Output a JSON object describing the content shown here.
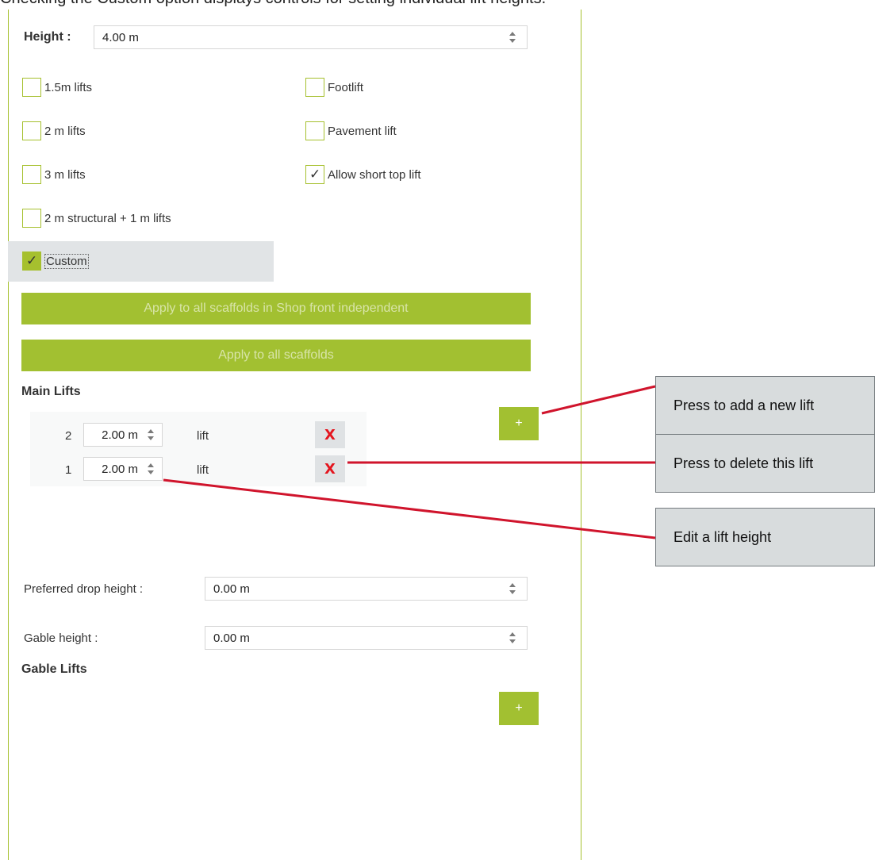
{
  "top_strip_text": "Checking the Custom option displays controls for setting individual lift heights.",
  "height": {
    "label": "Height :",
    "value": "4.00 m"
  },
  "options_left": [
    {
      "label": "1.5m lifts",
      "checked": false
    },
    {
      "label": "2 m lifts",
      "checked": false
    },
    {
      "label": "3 m lifts",
      "checked": false
    },
    {
      "label": "2 m structural + 1 m lifts",
      "checked": false
    }
  ],
  "options_right": [
    {
      "label": "Footlift",
      "checked": false
    },
    {
      "label": "Pavement lift",
      "checked": false
    },
    {
      "label": "Allow short top lift",
      "checked": true
    }
  ],
  "custom": {
    "label": "Custom",
    "checked": true
  },
  "apply_buttons": {
    "shop_front": "Apply to all scaffolds in Shop front independent",
    "all": "Apply to all scaffolds"
  },
  "main_lifts": {
    "title": "Main Lifts",
    "add_label": "+",
    "rows": [
      {
        "number": "2",
        "value": "2.00 m",
        "unit": "lift",
        "delete_label": "X"
      },
      {
        "number": "1",
        "value": "2.00 m",
        "unit": "lift",
        "delete_label": "X"
      }
    ]
  },
  "preferred_drop": {
    "label": "Preferred drop height :",
    "value": "0.00 m"
  },
  "gable_height": {
    "label": "Gable height :",
    "value": "0.00 m"
  },
  "gable_lifts": {
    "title": "Gable Lifts",
    "add_label": "+"
  },
  "callouts": {
    "add": "Press to add a new lift",
    "delete": "Press to delete this lift",
    "edit": "Edit a lift height"
  },
  "colors": {
    "accent_green": "#a2c031",
    "callout_line": "#d0142c",
    "delete_red": "#e4151e"
  }
}
